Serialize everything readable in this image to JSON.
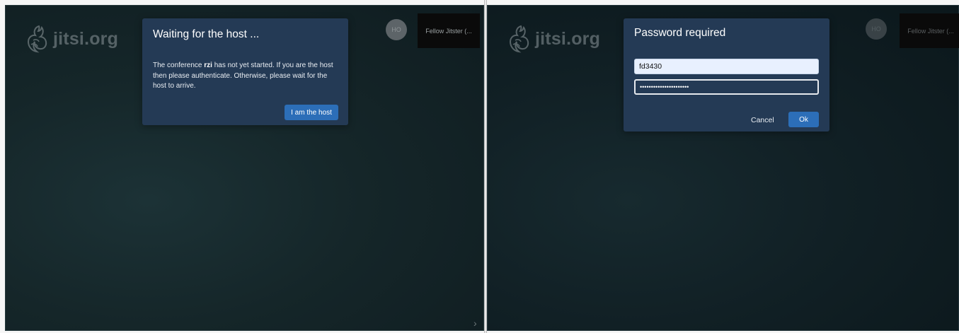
{
  "left_panel": {
    "logo_text": "jitsi.org",
    "avatar_initials": "HO",
    "thumbnail_label": "Fellow Jitster (...",
    "chevron": "›",
    "dialog": {
      "title": "Waiting for the host ...",
      "body_prefix": "The conference ",
      "room_name": "rzi",
      "body_suffix": " has not yet started. If you are the host then please authenticate. Otherwise, please wait for the host to arrive.",
      "host_button_label": "I am the host"
    }
  },
  "right_panel": {
    "logo_text": "jitsi.org",
    "avatar_initials": "HO",
    "thumbnail_label": "Fellow Jitster (...",
    "dialog": {
      "title": "Password required",
      "username_value": "fd3430",
      "password_value": "••••••••••••••••••••••",
      "cancel_label": "Cancel",
      "ok_label": "Ok"
    }
  },
  "colors": {
    "dialog_background": "#243a55",
    "primary_button": "#2c6eb8",
    "stage_background": "#152629"
  },
  "icons": {
    "logo": "jitsi-logo-icon",
    "filmstrip_toggle": "chevron-right-icon"
  }
}
